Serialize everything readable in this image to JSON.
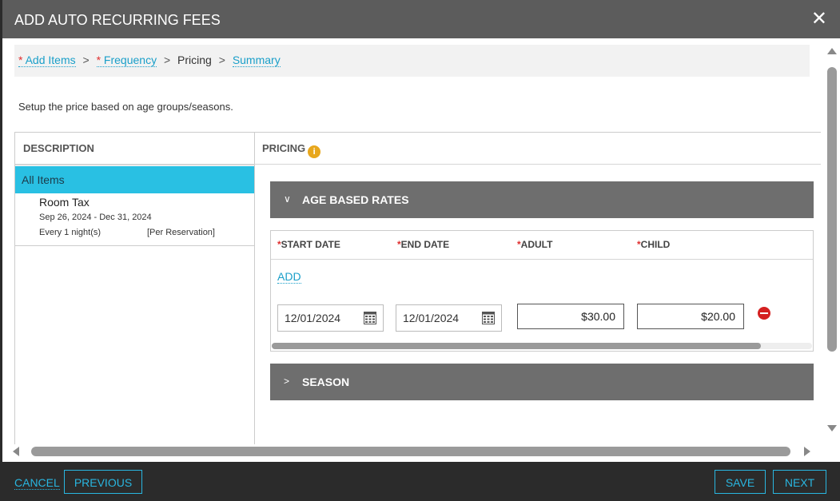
{
  "dialog": {
    "title": "ADD AUTO RECURRING FEES",
    "close_icon": "close-icon"
  },
  "breadcrumb": {
    "steps": [
      {
        "marker": "* ",
        "label": "Add Items"
      },
      {
        "marker": "* ",
        "label": "Frequency"
      },
      {
        "marker": "",
        "label": "Pricing"
      },
      {
        "marker": "",
        "label": "Summary"
      }
    ],
    "separator": ">"
  },
  "hint": "Setup the price based on age groups/seasons.",
  "description": {
    "header": "DESCRIPTION",
    "all_items_label": "All Items",
    "items": [
      {
        "name": "Room Tax",
        "dates": "Sep 26, 2024 - Dec 31, 2024",
        "frequency": "Every 1 night(s)",
        "per": "[Per Reservation]"
      }
    ]
  },
  "pricing": {
    "header": "PRICING",
    "info_icon": "i",
    "age_section": {
      "chevron": "∨",
      "title": "AGE BASED RATES",
      "required_mark": "*",
      "columns": [
        "START DATE",
        "END DATE",
        "ADULT",
        "CHILD"
      ],
      "add_label": "ADD",
      "rows": [
        {
          "start_date": "12/01/2024",
          "end_date": "12/01/2024",
          "adult": "$30.00",
          "child": "$20.00"
        }
      ]
    },
    "season_section": {
      "chevron": ">",
      "title": "SEASON"
    }
  },
  "footer": {
    "cancel": "CANCEL",
    "previous": "PREVIOUS",
    "save": "SAVE",
    "next": "NEXT"
  },
  "colors": {
    "header_bg": "#5c5c5c",
    "accent": "#1a9fc9",
    "selected_row": "#29c0e3",
    "section_bar": "#6e6e6e",
    "required": "#e03030",
    "info": "#e8a71c",
    "remove": "#d42020"
  }
}
